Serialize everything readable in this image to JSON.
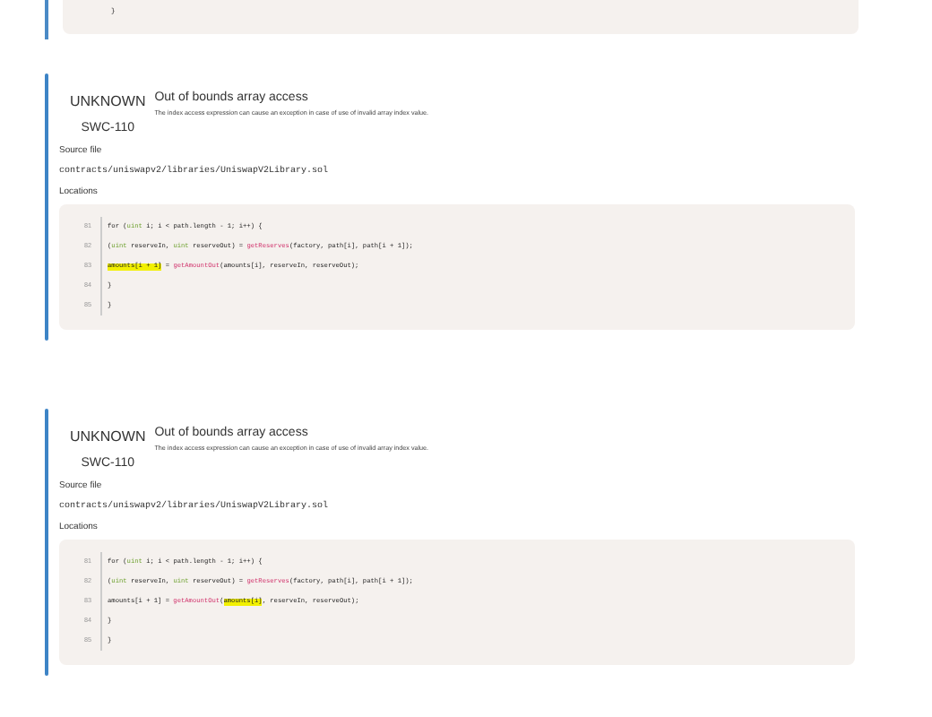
{
  "previous_card": {
    "code_lines": [
      "}"
    ]
  },
  "issues": [
    {
      "severity": "UNKNOWN",
      "swc": "SWC-110",
      "title": "Out of bounds array access",
      "description": "The index access expression can cause an exception in case of use of invalid array index value.",
      "source_label": "Source file",
      "source_path": "contracts/uniswapv2/libraries/UniswapV2Library.sol",
      "locations_label": "Locations",
      "code_lines": [
        {
          "number": "81",
          "tokens": [
            {
              "kind": "plain",
              "text": "for ("
            },
            {
              "kind": "type",
              "text": "uint"
            },
            {
              "kind": "plain",
              "text": " i; i < path.length - 1; i++) {"
            }
          ]
        },
        {
          "number": "82",
          "tokens": [
            {
              "kind": "plain",
              "text": "("
            },
            {
              "kind": "type",
              "text": "uint"
            },
            {
              "kind": "plain",
              "text": " reserveIn, "
            },
            {
              "kind": "type",
              "text": "uint"
            },
            {
              "kind": "plain",
              "text": " reserveOut) = "
            },
            {
              "kind": "function",
              "text": "getReserves"
            },
            {
              "kind": "plain",
              "text": "(factory, path[i], path[i + 1]);"
            }
          ]
        },
        {
          "number": "83",
          "tokens": [
            {
              "kind": "highlight",
              "text": "amounts[i + 1]"
            },
            {
              "kind": "plain",
              "text": " = "
            },
            {
              "kind": "function",
              "text": "getAmountOut"
            },
            {
              "kind": "plain",
              "text": "(amounts[i], reserveIn, reserveOut);"
            }
          ]
        },
        {
          "number": "84",
          "tokens": [
            {
              "kind": "plain",
              "text": "}"
            }
          ]
        },
        {
          "number": "85",
          "tokens": [
            {
              "kind": "plain",
              "text": "}"
            }
          ]
        }
      ]
    },
    {
      "severity": "UNKNOWN",
      "swc": "SWC-110",
      "title": "Out of bounds array access",
      "description": "The index access expression can cause an exception in case of use of invalid array index value.",
      "source_label": "Source file",
      "source_path": "contracts/uniswapv2/libraries/UniswapV2Library.sol",
      "locations_label": "Locations",
      "code_lines": [
        {
          "number": "81",
          "tokens": [
            {
              "kind": "plain",
              "text": "for ("
            },
            {
              "kind": "type",
              "text": "uint"
            },
            {
              "kind": "plain",
              "text": " i; i < path.length - 1; i++) {"
            }
          ]
        },
        {
          "number": "82",
          "tokens": [
            {
              "kind": "plain",
              "text": "("
            },
            {
              "kind": "type",
              "text": "uint"
            },
            {
              "kind": "plain",
              "text": " reserveIn, "
            },
            {
              "kind": "type",
              "text": "uint"
            },
            {
              "kind": "plain",
              "text": " reserveOut) = "
            },
            {
              "kind": "function",
              "text": "getReserves"
            },
            {
              "kind": "plain",
              "text": "(factory, path[i], path[i + 1]);"
            }
          ]
        },
        {
          "number": "83",
          "tokens": [
            {
              "kind": "plain",
              "text": "amounts[i + 1] = "
            },
            {
              "kind": "function",
              "text": "getAmountOut"
            },
            {
              "kind": "plain",
              "text": "("
            },
            {
              "kind": "highlight",
              "text": "amounts[i]"
            },
            {
              "kind": "plain",
              "text": ", reserveIn, reserveOut);"
            }
          ]
        },
        {
          "number": "84",
          "tokens": [
            {
              "kind": "plain",
              "text": "}"
            }
          ]
        },
        {
          "number": "85",
          "tokens": [
            {
              "kind": "plain",
              "text": "}"
            }
          ]
        }
      ]
    }
  ]
}
